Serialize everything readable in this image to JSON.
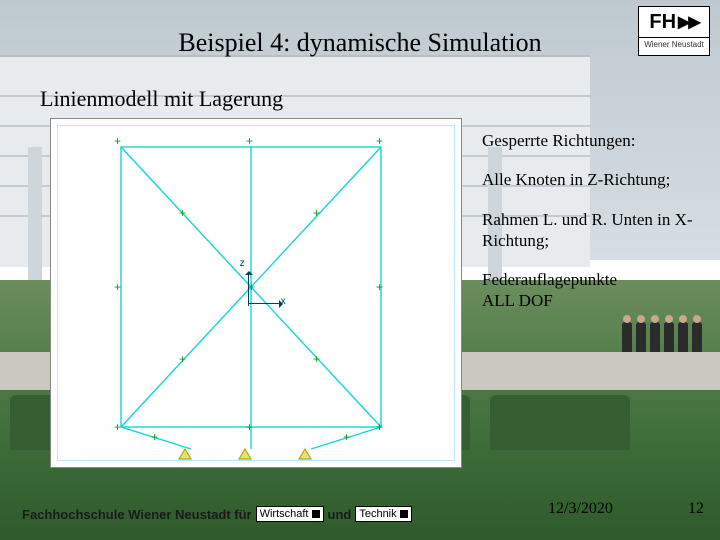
{
  "logo": {
    "fh": "FH",
    "sub": "Wiener Neustadt"
  },
  "title": "Beispiel 4: dynamische Simulation",
  "subtitle": "Linienmodell mit Lagerung",
  "axis": {
    "z": "z",
    "x": "x"
  },
  "notes": {
    "heading": "Gesperrte Richtungen:",
    "line1": "Alle Knoten in Z-Richtung;",
    "line2": "Rahmen L. und R. Unten in X-Richtung;",
    "line3a": "Federauflagepunkte",
    "line3b": "ALL DOF"
  },
  "footer": {
    "text_a": "Fachhochschule Wiener Neustadt für",
    "tag1": "Wirtschaft",
    "mid": "und",
    "tag2": "Technik",
    "date": "12/3/2020",
    "page": "12"
  }
}
